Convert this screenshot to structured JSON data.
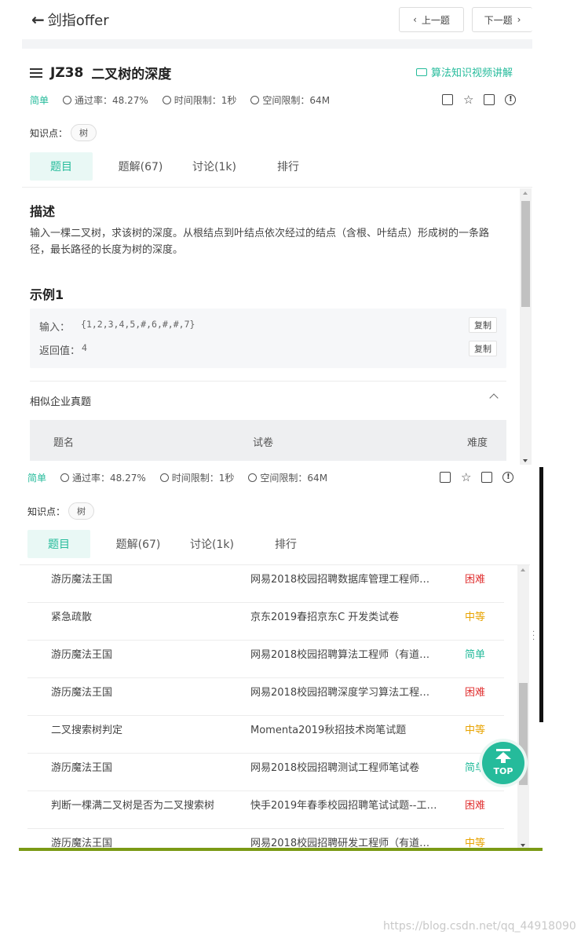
{
  "header": {
    "back_label": "剑指offer",
    "prev_label": "上一题",
    "next_label": "下一题"
  },
  "problem": {
    "id": "JZ38",
    "title": "二叉树的深度",
    "video_link": "算法知识视频讲解",
    "difficulty": "简单",
    "pass_rate": "通过率：48.27%",
    "time_limit": "时间限制：1秒",
    "space_limit": "空间限制：64M",
    "knowledge_label": "知识点：",
    "tag": "树"
  },
  "tabs": [
    "题目",
    "题解(67)",
    "讨论(1k)",
    "排行"
  ],
  "description": {
    "heading": "描述",
    "text": "输入一棵二叉树，求该树的深度。从根结点到叶结点依次经过的结点（含根、叶结点）形成树的一条路径，最长路径的长度为树的深度。"
  },
  "example": {
    "heading": "示例1",
    "input_label": "输入：",
    "input_value": "{1,2,3,4,5,#,6,#,#,7}",
    "return_label": "返回值：",
    "return_value": "4",
    "copy_label": "复制"
  },
  "similar": {
    "title": "相似企业真题",
    "headers": [
      "题名",
      "试卷",
      "难度"
    ],
    "rows": [
      {
        "name": "游历魔法王国",
        "paper": "网易2018校园招聘数据库管理工程师…",
        "difficulty": "困难"
      },
      {
        "name": "紧急疏散",
        "paper": "京东2019春招京东C 开发类试卷",
        "difficulty": "中等"
      },
      {
        "name": "游历魔法王国",
        "paper": "网易2018校园招聘算法工程师（有道…",
        "difficulty": "简单"
      },
      {
        "name": "游历魔法王国",
        "paper": "网易2018校园招聘深度学习算法工程…",
        "difficulty": "困难"
      },
      {
        "name": "二叉搜索树判定",
        "paper": "Momenta2019秋招技术岗笔试题",
        "difficulty": "中等"
      },
      {
        "name": "游历魔法王国",
        "paper": "网易2018校园招聘测试工程师笔试卷",
        "difficulty": "简单"
      },
      {
        "name": "判断一棵满二叉树是否为二叉搜索树",
        "paper": "快手2019年春季校园招聘笔试试题--工…",
        "difficulty": "困难"
      },
      {
        "name": "游历魔法王国",
        "paper": "网易2018校园招聘研发工程师（有道…",
        "difficulty": "中等"
      }
    ]
  },
  "top_button": "TOP",
  "watermark": "https://blog.csdn.net/qq_44918090",
  "colors": {
    "accent": "#25bb9b",
    "hard": "#e03030",
    "medium": "#e8a300"
  }
}
